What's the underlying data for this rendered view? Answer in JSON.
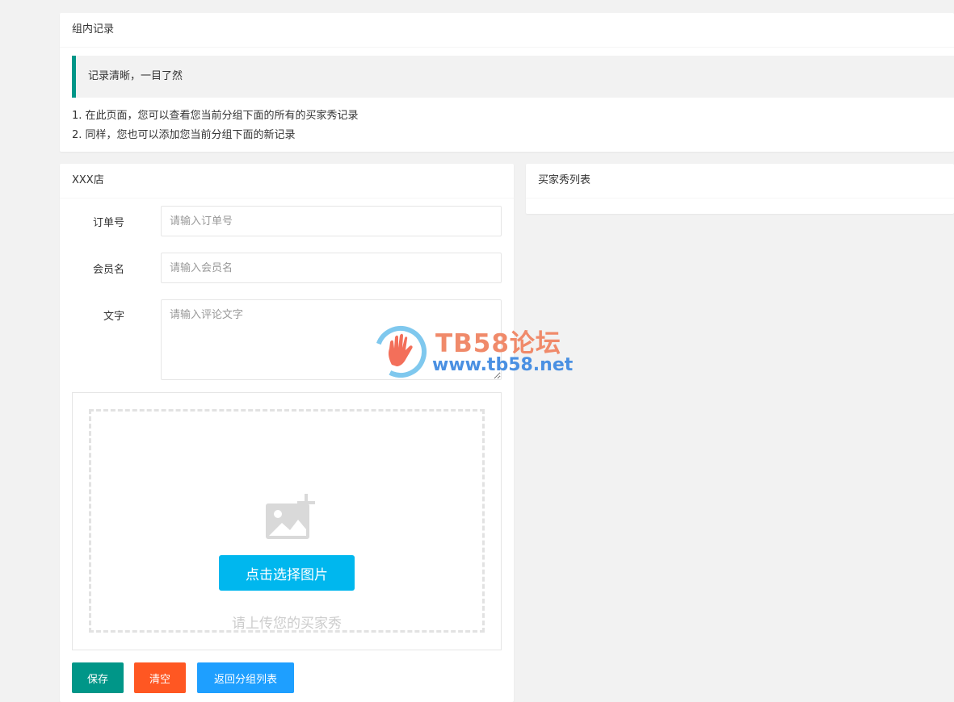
{
  "records_card": {
    "title": "组内记录",
    "quote": "记录清晰，一目了然",
    "notes": [
      "1. 在此页面，您可以查看您当前分组下面的所有的买家秀记录",
      "2. 同样，您也可以添加您当前分组下面的新记录"
    ]
  },
  "shop_card": {
    "title": "XXX店",
    "fields": {
      "order": {
        "label": "订单号",
        "placeholder": "请输入订单号",
        "value": ""
      },
      "member": {
        "label": "会员名",
        "placeholder": "请输入会员名",
        "value": ""
      },
      "text": {
        "label": "文字",
        "placeholder": "请输入评论文字",
        "value": ""
      }
    },
    "upload": {
      "icon": "image-add-icon",
      "button_label": "点击选择图片",
      "hint": "请上传您的买家秀"
    },
    "actions": {
      "save": "保存",
      "clear": "清空",
      "back": "返回分组列表"
    }
  },
  "list_card": {
    "title": "买家秀列表"
  },
  "watermark": {
    "title": "TB58论坛",
    "url": "www.tb58.net"
  },
  "colors": {
    "accent_green": "#009688",
    "danger_orange": "#ff5722",
    "info_blue": "#1e9fff",
    "upload_blue": "#00b7ee",
    "background": "#f2f2f2"
  }
}
